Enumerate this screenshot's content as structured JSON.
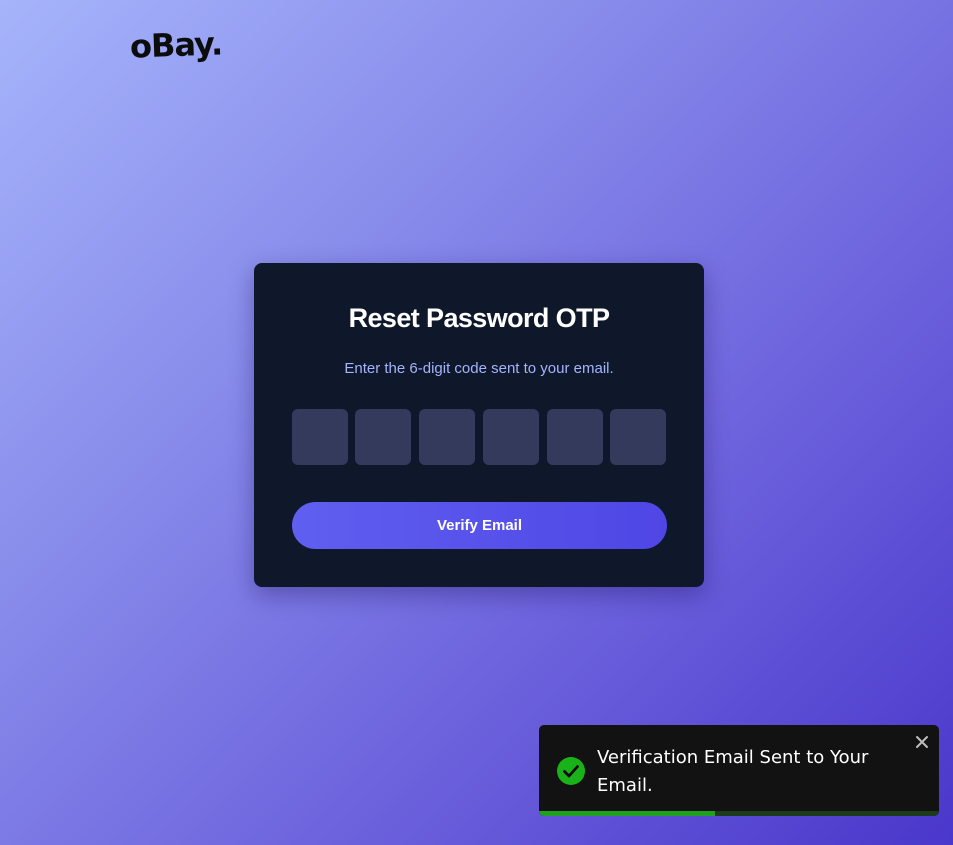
{
  "brand": {
    "logo_text": "oBay."
  },
  "card": {
    "title": "Reset Password OTP",
    "subtitle": "Enter the 6-digit code sent to your email.",
    "otp_digits": [
      "",
      "",
      "",
      "",
      "",
      ""
    ],
    "verify_label": "Verify Email"
  },
  "toast": {
    "message": "Verification Email Sent to Your Email.",
    "icon": "check-circle-icon",
    "close_icon": "close-icon",
    "progress_fraction": 0.44
  },
  "colors": {
    "card_bg": "#0f172a",
    "accent": "#4f46e5",
    "subtitle": "#a5b4fc",
    "success": "#1fa01f"
  }
}
